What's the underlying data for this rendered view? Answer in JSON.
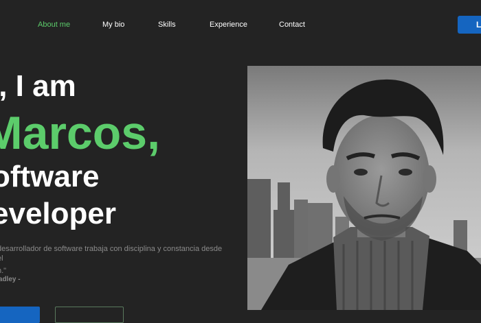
{
  "nav": {
    "items": [
      {
        "label": "About me",
        "active": true
      },
      {
        "label": "My bio"
      },
      {
        "label": "Skills"
      },
      {
        "label": "Experience"
      },
      {
        "label": "Contact"
      }
    ],
    "cta_label": "L"
  },
  "hero": {
    "line1": "i, I am",
    "line2": "Marcos,",
    "line3": "oftware",
    "line4": "eveloper",
    "quote_line1": "desarrollador de software trabaja con disciplina y constancia desde el",
    "quote_line2": "n.\"",
    "author": "radley -"
  },
  "colors": {
    "accent_green": "#5ccc6b",
    "accent_blue": "#1565c0",
    "background": "#232323"
  },
  "photo": {
    "subject": "portrait-photo"
  }
}
